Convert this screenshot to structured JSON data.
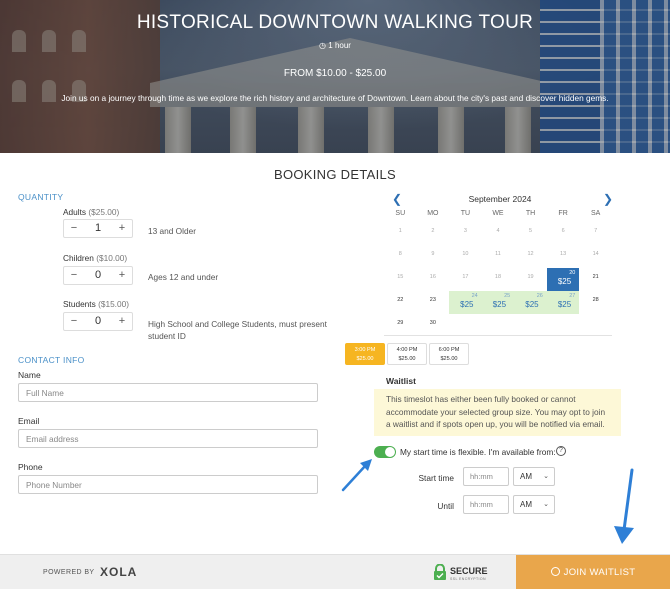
{
  "hero": {
    "title": "HISTORICAL DOWNTOWN WALKING TOUR",
    "duration": "1 hour",
    "price_range": "FROM $10.00 - $25.00",
    "description": "Join us on a journey through time as we explore the rich history and architecture of Downtown. Learn about the city's past and discover hidden gems."
  },
  "booking": {
    "title": "BOOKING DETAILS"
  },
  "quantity": {
    "label": "QUANTITY",
    "items": [
      {
        "name": "Adults",
        "price": "($25.00)",
        "value": "1",
        "desc": "13 and Older"
      },
      {
        "name": "Children",
        "price": "($10.00)",
        "value": "0",
        "desc": "Ages 12 and under"
      },
      {
        "name": "Students",
        "price": "($15.00)",
        "value": "0",
        "desc": "High School and College Students, must present student ID"
      }
    ]
  },
  "contact": {
    "label": "CONTACT INFO",
    "name_label": "Name",
    "name_placeholder": "Full Name",
    "email_label": "Email",
    "email_placeholder": "Email address",
    "phone_label": "Phone",
    "phone_placeholder": "Phone Number"
  },
  "calendar": {
    "month": "September 2024",
    "weekdays": [
      "SU",
      "MO",
      "TU",
      "WE",
      "TH",
      "FR",
      "SA"
    ],
    "weeks": [
      [
        {
          "d": "1"
        },
        {
          "d": "2"
        },
        {
          "d": "3"
        },
        {
          "d": "4"
        },
        {
          "d": "5"
        },
        {
          "d": "6"
        },
        {
          "d": "7"
        }
      ],
      [
        {
          "d": "8"
        },
        {
          "d": "9"
        },
        {
          "d": "10"
        },
        {
          "d": "11"
        },
        {
          "d": "12"
        },
        {
          "d": "13"
        },
        {
          "d": "14"
        }
      ],
      [
        {
          "d": "15"
        },
        {
          "d": "16"
        },
        {
          "d": "17"
        },
        {
          "d": "18"
        },
        {
          "d": "19"
        },
        {
          "d": "20",
          "price": "$25",
          "selected": true
        },
        {
          "d": "21",
          "dark": true
        }
      ],
      [
        {
          "d": "22",
          "dark": true
        },
        {
          "d": "23",
          "dark": true
        },
        {
          "d": "24",
          "price": "$25"
        },
        {
          "d": "25",
          "price": "$25"
        },
        {
          "d": "26",
          "price": "$25"
        },
        {
          "d": "27",
          "price": "$25"
        },
        {
          "d": "28",
          "dark": true
        }
      ],
      [
        {
          "d": "29",
          "dark": true
        },
        {
          "d": "30",
          "dark": true
        }
      ]
    ]
  },
  "timeslots": [
    {
      "time": "3:00 PM",
      "price": "$25.00",
      "selected": true
    },
    {
      "time": "4:00 PM",
      "price": "$25.00"
    },
    {
      "time": "6:00 PM",
      "price": "$25.00"
    }
  ],
  "waitlist": {
    "title": "Waitlist",
    "notice": "This timeslot has either been fully booked or cannot accommodate your selected group size. You may opt to join a waitlist and if spots open up, you will be notified via email.",
    "flexible_label": "My start time is flexible. I'm available from:",
    "flexible_on": true,
    "start_label": "Start time",
    "until_label": "Until",
    "time_placeholder": "hh:mm",
    "start_ampm": "AM",
    "until_ampm": "AM"
  },
  "footer": {
    "powered_by": "POWERED BY",
    "brand": "XOLA",
    "secure": "SECURE",
    "secure_sub": "SSL ENCRYPTION",
    "join_label": "JOIN WAITLIST"
  },
  "colors": {
    "primary_blue": "#2d6fb3",
    "available_green": "#dcf1cf",
    "selected_slot": "#f6b521",
    "join_button": "#e9a64b",
    "toggle_on": "#4caf50"
  }
}
